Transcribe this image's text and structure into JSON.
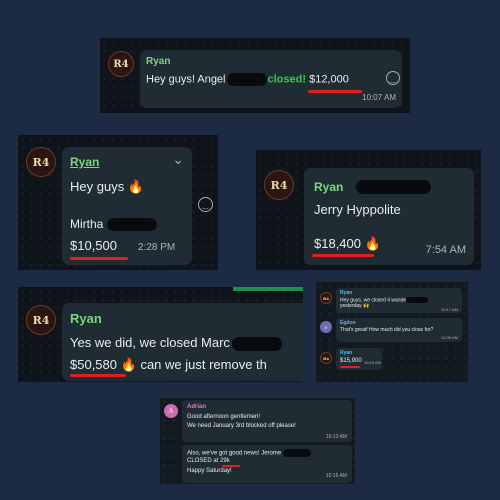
{
  "avatar_initials": "R4",
  "p1": {
    "name": "Ryan",
    "text_before": "Hey guys! Angel",
    "text_closed": "closed!",
    "amount": "$12,000",
    "time": "10:07 AM"
  },
  "p2": {
    "name": "Ryan",
    "line1": "Hey guys",
    "line2": "Mirtha",
    "amount": "$10,500",
    "time": "2:28 PM"
  },
  "p3": {
    "name": "Ryan",
    "line1": "Jerry Hyppolite",
    "amount": "$18,400",
    "time": "7:54 AM"
  },
  "p4": {
    "name": "Ryan",
    "line1": "Yes we did, we closed Marc",
    "amount": "$50,580",
    "line2_rest": "can we just remove th"
  },
  "p5": {
    "msg1_name": "Ryan",
    "msg1_line1": "Hey guys, we closed 4 wande",
    "msg1_line2": "yesterday",
    "msg1_time": "10:17 AM",
    "msg2_name": "Egdon",
    "msg2_text": "That's great! How much did you close for?",
    "msg2_time": "10:39 AM",
    "msg3_name": "Ryan",
    "msg3_amount": "$15,900",
    "msg3_time": "10:19 AM"
  },
  "p6": {
    "name": "Adrian",
    "msg1_line1": "Good afternoon gentlemen!",
    "msg1_line2": "We need January 3rd blocked off please!",
    "msg1_time": "10:13 AM",
    "msg2_line1": "Also, we've got good news! Jerome",
    "msg2_line2": "CLOSED at 29k",
    "msg2_line3": "Happy Saturday!",
    "msg2_time": "10:16 AM"
  }
}
